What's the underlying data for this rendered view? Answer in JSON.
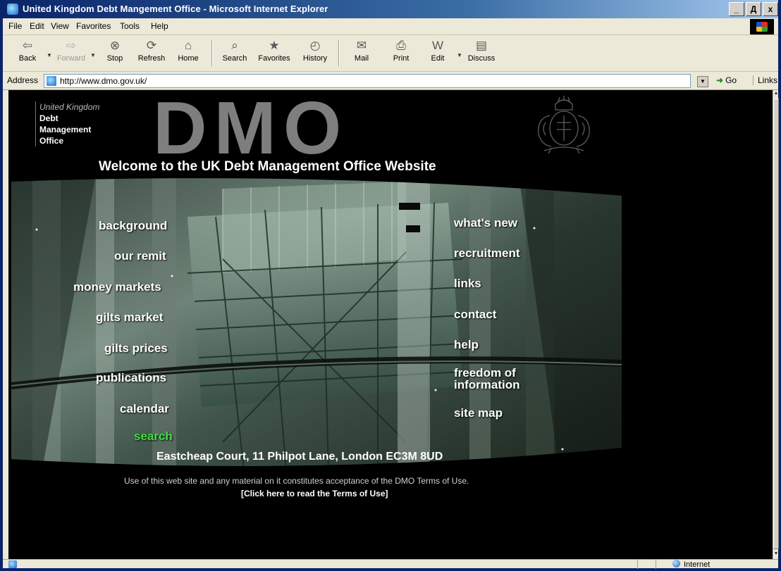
{
  "window": {
    "title": "United Kingdom Debt Mangement Office - Microsoft Internet Explorer",
    "buttons": [
      "_",
      "Д",
      "x"
    ]
  },
  "menubar": {
    "items": [
      "File",
      "Edit",
      "View",
      "Favorites",
      "Tools",
      "Help"
    ]
  },
  "toolbar": {
    "buttons": [
      {
        "label": "Back",
        "icon": "back-arrow-icon",
        "glyph": "⇦"
      },
      {
        "label": "Forward",
        "icon": "forward-arrow-icon",
        "glyph": "⇨"
      },
      {
        "label": "Stop",
        "icon": "stop-icon",
        "glyph": "⊗"
      },
      {
        "label": "Refresh",
        "icon": "refresh-icon",
        "glyph": "⟳"
      },
      {
        "label": "Home",
        "icon": "home-icon",
        "glyph": "⌂"
      },
      {
        "label": "Search",
        "icon": "search-icon",
        "glyph": "⌕"
      },
      {
        "label": "Favorites",
        "icon": "favorites-icon",
        "glyph": "★"
      },
      {
        "label": "History",
        "icon": "history-icon",
        "glyph": "◴"
      },
      {
        "label": "Mail",
        "icon": "mail-icon",
        "glyph": "✉"
      },
      {
        "label": "Print",
        "icon": "print-icon",
        "glyph": "⎙"
      },
      {
        "label": "Edit",
        "icon": "edit-icon",
        "glyph": "W"
      },
      {
        "label": "Discuss",
        "icon": "discuss-icon",
        "glyph": "▤"
      }
    ]
  },
  "addressbar": {
    "label": "Address",
    "url": "http://www.dmo.gov.uk/",
    "go_label": "Go",
    "links_label": "Links"
  },
  "page": {
    "org_line1": "United Kingdom",
    "org_line2": "Debt",
    "org_line3": "Management",
    "org_line4": "Office",
    "logo_text": "DMO",
    "welcome": "Welcome to the UK Debt Management Office Website",
    "left_nav": [
      "background",
      "our remit",
      "money markets",
      "gilts market",
      "gilts prices",
      "publications",
      "calendar",
      "search"
    ],
    "right_nav": [
      "what's new",
      "recruitment",
      "links",
      "contact",
      "help",
      "freedom of information",
      "site map"
    ],
    "address": "Eastcheap Court, 11 Philpot Lane, London EC3M 8UD",
    "terms_text": "Use of this web site and any material on it constitutes acceptance of the DMO Terms of Use.",
    "terms_link": "[Click here to read the Terms of Use]"
  },
  "statusbar": {
    "zone": "Internet"
  },
  "colors": {
    "search_link": "#3fe03f",
    "titlebar": "#0a246a",
    "background": "#000000"
  }
}
